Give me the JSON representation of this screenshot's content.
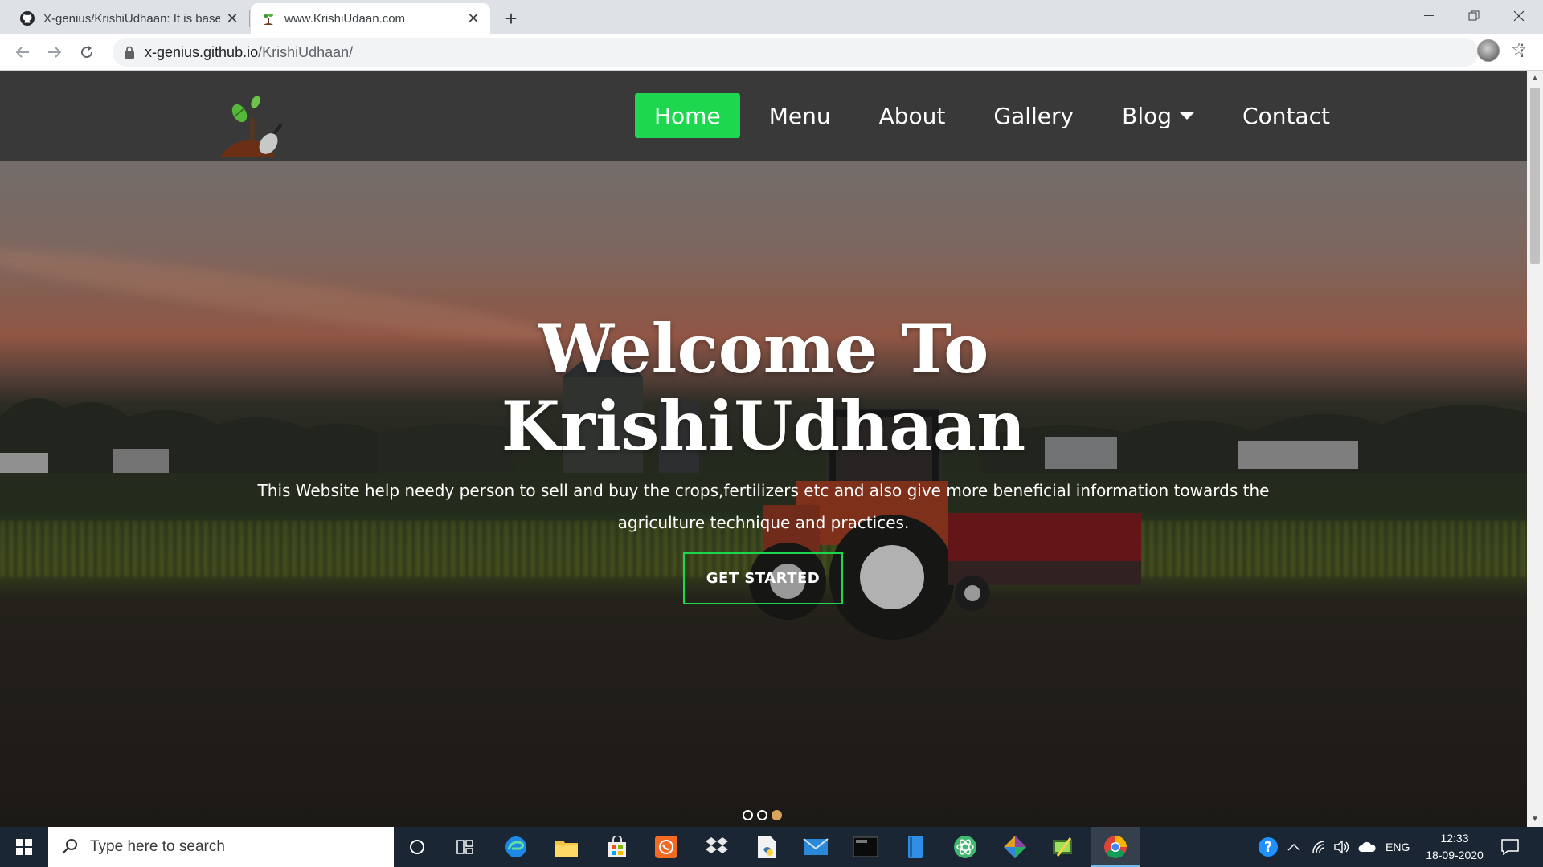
{
  "browser": {
    "tabs": [
      {
        "title": "X-genius/KrishiUdhaan: It is based",
        "active": false
      },
      {
        "title": "www.KrishiUdaan.com",
        "active": true
      }
    ],
    "url_host": "x-genius.github.io",
    "url_path": "/KrishiUdhaan/"
  },
  "site": {
    "nav": [
      {
        "label": "Home",
        "active": true
      },
      {
        "label": "Menu"
      },
      {
        "label": "About"
      },
      {
        "label": "Gallery"
      },
      {
        "label": "Blog",
        "dropdown": true
      },
      {
        "label": "Contact"
      }
    ],
    "hero": {
      "title_line1": "Welcome To",
      "title_line2": "KrishiUdhaan",
      "description": "This Website help needy person to sell and buy the crops,fertilizers etc and also give more beneficial information towards the agriculture technique and practices.",
      "cta_label": "GET STARTED",
      "slides": 3,
      "active_slide": 3
    },
    "colors": {
      "accent": "#1dd84f",
      "header_bg": "#323232",
      "dot_active": "#d9a45a"
    }
  },
  "taskbar": {
    "search_placeholder": "Type here to search",
    "language": "ENG",
    "time": "12:33",
    "date": "18-09-2020"
  }
}
